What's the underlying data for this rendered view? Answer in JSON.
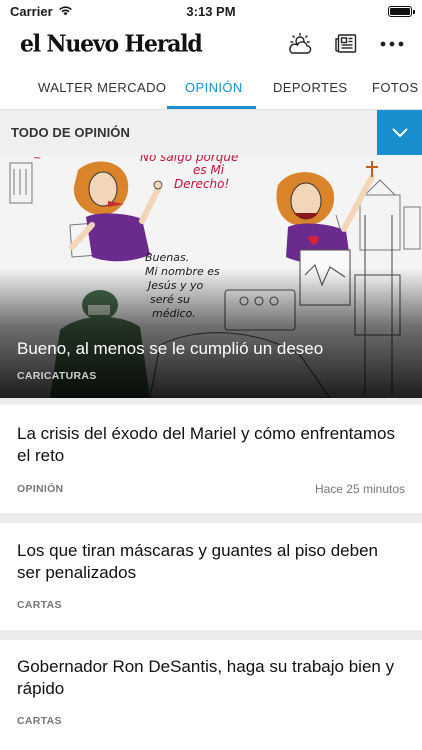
{
  "status_bar": {
    "carrier": "Carrier",
    "time": "3:13 PM"
  },
  "header": {
    "logo": "el Nuevo Herald",
    "icons": [
      "weather-icon",
      "newspaper-icon",
      "more-icon"
    ]
  },
  "tabs": [
    {
      "label": "WALTER MERCADO",
      "active": false
    },
    {
      "label": "OPINIÓN",
      "active": true
    },
    {
      "label": "DEPORTES",
      "active": false
    },
    {
      "label": "FOTOS D",
      "active": false
    }
  ],
  "section": {
    "title": "TODO DE OPINIÓN"
  },
  "hero": {
    "headline": "Bueno, al menos se le cumplió un deseo",
    "category": "CARICATURAS",
    "cartoon_text": {
      "top": "Mi Derecho!",
      "top_partial": "No salgo ... es Mi",
      "doctor": "Buenas. Mi nombre es Jesús y yo seré su médico."
    }
  },
  "articles": [
    {
      "title": "La crisis del éxodo del Mariel y cómo enfrentamos el reto",
      "category": "OPINIÓN",
      "time": "Hace 25 minutos"
    },
    {
      "title": "Los que tiran máscaras y guantes al piso deben ser penalizados",
      "category": "CARTAS",
      "time": ""
    },
    {
      "title": "Gobernador Ron DeSantis, haga su trabajo bien y rápido",
      "category": "CARTAS",
      "time": ""
    }
  ],
  "colors": {
    "accent": "#1a8fcf",
    "section_bg": "#efefef",
    "divider": "#ececec"
  }
}
